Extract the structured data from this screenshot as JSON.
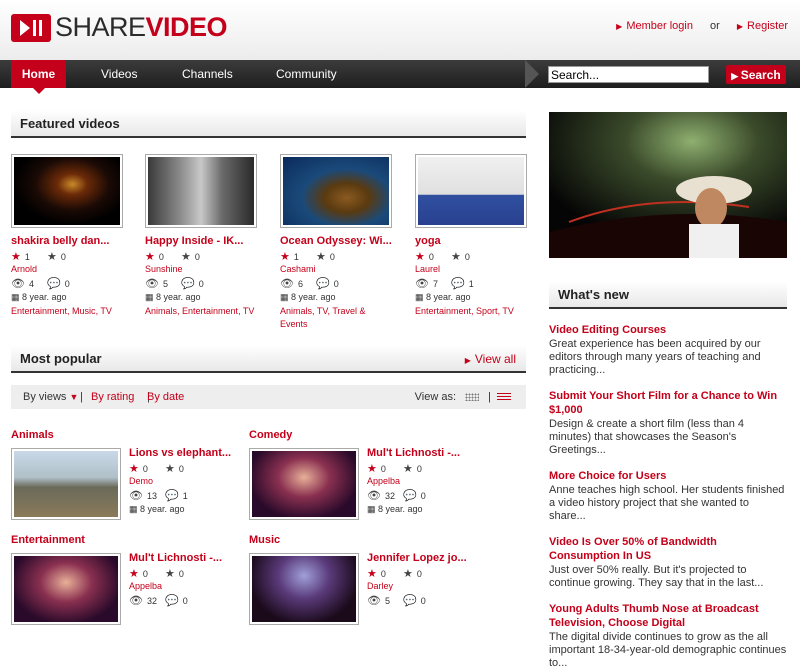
{
  "brand": {
    "share": "SHARE",
    "video": "VIDEO"
  },
  "top_links": {
    "login": "Member login",
    "or": "or",
    "register": "Register"
  },
  "nav": {
    "items": [
      "Home",
      "Videos",
      "Channels",
      "Community"
    ]
  },
  "search": {
    "value": "Search...",
    "button": "Search"
  },
  "featured": {
    "title": "Featured videos",
    "videos": [
      {
        "title": "shakira belly dan...",
        "user": "Arnold",
        "rating_red": "1",
        "rating_dark": "0",
        "views": "4",
        "comments": "0",
        "date": "8 year. ago",
        "categories": [
          "Entertainment",
          "Music",
          "TV"
        ]
      },
      {
        "title": "Happy Inside - IK...",
        "user": "Sunshine",
        "rating_red": "0",
        "rating_dark": "0",
        "views": "5",
        "comments": "0",
        "date": "8 year. ago",
        "categories": [
          "Animals",
          "Entertainment",
          "TV"
        ]
      },
      {
        "title": "Ocean Odyssey: Wi...",
        "user": "Cashami",
        "rating_red": "1",
        "rating_dark": "0",
        "views": "6",
        "comments": "0",
        "date": "8 year. ago",
        "categories": [
          "Animals",
          "TV",
          "Travel &",
          "Events"
        ]
      },
      {
        "title": "yoga",
        "user": "Laurel",
        "rating_red": "0",
        "rating_dark": "0",
        "views": "7",
        "comments": "1",
        "date": "8 year. ago",
        "categories": [
          "Entertainment",
          "Sport",
          "TV"
        ]
      }
    ]
  },
  "popular": {
    "title": "Most popular",
    "view_all": "View all",
    "filters": {
      "views": "By views",
      "rating": "By rating",
      "date": "By date",
      "view_as": "View as:"
    },
    "categories": [
      {
        "category": "Animals",
        "title": "Lions vs elephant...",
        "user": "Demo",
        "rating_red": "0",
        "rating_dark": "0",
        "views": "13",
        "comments": "1",
        "date": "8 year. ago"
      },
      {
        "category": "Comedy",
        "title": "Mul't Lichnosti -...",
        "user": "Appelba",
        "rating_red": "0",
        "rating_dark": "0",
        "views": "32",
        "comments": "0",
        "date": "8 year. ago"
      },
      {
        "category": "Entertainment",
        "title": "Mul't Lichnosti -...",
        "user": "Appelba",
        "rating_red": "0",
        "rating_dark": "0",
        "views": "32",
        "comments": "0",
        "date": ""
      },
      {
        "category": "Music",
        "title": "Jennifer Lopez jo...",
        "user": "Darley",
        "rating_red": "0",
        "rating_dark": "0",
        "views": "5",
        "comments": "0",
        "date": ""
      }
    ]
  },
  "whats_new": {
    "title": "What's new",
    "items": [
      {
        "title": "Video Editing Courses",
        "body": "Great experience has been acquired by our editors through many years of teaching and practicing..."
      },
      {
        "title": "Submit Your Short Film for a Chance to Win $1,000",
        "body": "Design & create a short film (less than 4 minutes) that showcases the Season's Greetings..."
      },
      {
        "title": "More Choice for Users",
        "body": "Anne teaches high school. Her students finished a video history project that she wanted to share..."
      },
      {
        "title": "Video Is Over 50% of Bandwidth Consumption In US",
        "body": "Just over 50% really. But it's projected to continue growing. They say that in the last..."
      },
      {
        "title": "Young Adults Thumb Nose at Broadcast Television, Choose Digital",
        "body": "The digital divide continues to grow as the all important 18-34-year-old demographic continues to..."
      }
    ]
  },
  "colors": {
    "accent": "#c4001a",
    "nav_bg": "#2a2a2a"
  }
}
